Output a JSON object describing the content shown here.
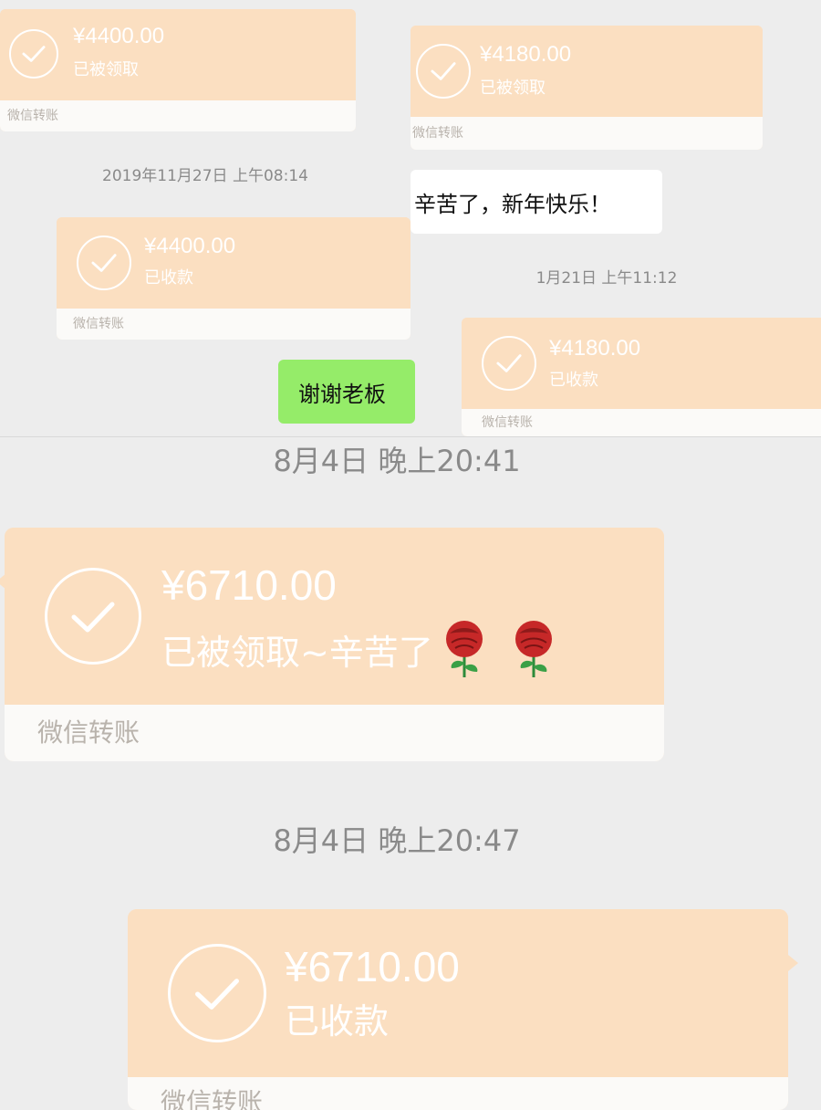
{
  "transfer_label": "微信转账",
  "colors": {
    "card_orange": "#fbdfc1",
    "card_footer": "#fbfaf8",
    "bubble_green": "#95ec69",
    "bubble_white": "#ffffff",
    "background": "#ededed",
    "rose_red": "#c62828"
  },
  "left_panel": {
    "card1": {
      "amount": "¥4400.00",
      "status": "已被领取",
      "footer": "微信转账",
      "icon": "check-circle-icon"
    },
    "timestamp": "2019年11月27日 上午08:14",
    "card2": {
      "amount": "¥4400.00",
      "status": "已收款",
      "footer": "微信转账",
      "icon": "check-circle-icon"
    },
    "reply": "谢谢老板"
  },
  "right_panel": {
    "card1": {
      "amount": "¥4180.00",
      "status": "已被领取",
      "footer": "微信转账",
      "icon": "check-circle-icon"
    },
    "message": "辛苦了，新年快乐！",
    "timestamp": "1月21日 上午11:12",
    "card2": {
      "amount": "¥4180.00",
      "status": "已收款",
      "footer": "微信转账",
      "icon": "check-circle-icon"
    }
  },
  "bottom_panel": {
    "timestamp1": "8月4日 晚上20:41",
    "card1": {
      "amount": "¥6710.00",
      "status": "已被领取~辛苦了",
      "emoji": [
        "rose-icon",
        "rose-icon"
      ],
      "footer": "微信转账",
      "icon": "check-circle-icon"
    },
    "timestamp2": "8月4日 晚上20:47",
    "card2": {
      "amount": "¥6710.00",
      "status": "已收款",
      "footer": "微信转账",
      "icon": "check-circle-icon"
    }
  }
}
